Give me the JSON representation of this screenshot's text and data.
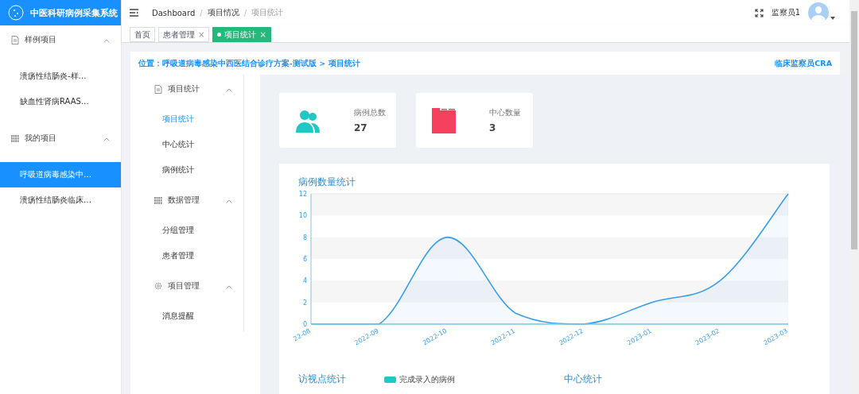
{
  "sidebar": {
    "title": "中医科研病例采集系统",
    "groups": [
      {
        "label": "样例项目",
        "expanded": true,
        "items": [
          {
            "label": "溃疡性结肠炎-样…",
            "selected": false
          },
          {
            "label": "缺血性肾病RAAS…",
            "selected": false
          }
        ]
      },
      {
        "label": "我的项目",
        "expanded": true,
        "items": [
          {
            "label": "呼吸道病毒感染中…",
            "selected": true
          },
          {
            "label": "溃疡性结肠炎临床…",
            "selected": false
          }
        ]
      }
    ]
  },
  "topbar": {
    "breadcrumb": [
      "Dashboard",
      "/",
      "项目情况",
      "/",
      "项目统计"
    ],
    "user": "监察员1"
  },
  "tabs": [
    {
      "label": "首页",
      "selected": false
    },
    {
      "label": "患者管理",
      "selected": false,
      "close": "×"
    },
    {
      "label": "项目统计",
      "selected": true,
      "close": "×"
    }
  ],
  "location": {
    "path": "位置：呼吸道病毒感染中西医结合诊疗方案-测试版 > 项目统计",
    "role": "临床监察员CRA"
  },
  "submenu": [
    {
      "label": "项目统计",
      "expanded": true,
      "items": [
        {
          "label": "项目统计",
          "selected": true
        },
        {
          "label": "中心统计",
          "selected": false
        },
        {
          "label": "病例统计",
          "selected": false
        }
      ]
    },
    {
      "label": "数据管理",
      "expanded": true,
      "items": [
        {
          "label": "分组管理",
          "selected": false
        },
        {
          "label": "患者管理",
          "selected": false
        }
      ]
    },
    {
      "label": "项目管理",
      "expanded": true,
      "items": [
        {
          "label": "消息提醒",
          "selected": false
        }
      ]
    }
  ],
  "stats": [
    {
      "label": "病例总数",
      "value": "27",
      "color": "#1fc8c4"
    },
    {
      "label": "中心数量",
      "value": "3",
      "color": "#f5405e"
    }
  ],
  "chart": {
    "title": "病例数量统计",
    "chart_data": {
      "type": "area",
      "categories": [
        "22-08",
        "2022-09",
        "2022-10",
        "2022-11",
        "2022-12",
        "2023-01",
        "2023-02",
        "2023-03"
      ],
      "series": [
        {
          "color": "#3a9ee8",
          "values": [
            0,
            0,
            8,
            1,
            0,
            2,
            4,
            12
          ]
        }
      ],
      "ylim": [
        0,
        12
      ],
      "yticks": [
        0,
        2,
        4,
        6,
        8,
        10,
        12
      ]
    }
  },
  "bottom": [
    {
      "title": "访视点统计",
      "legend": {
        "label": "完成录入的病例",
        "color": "#1fc8c4"
      }
    },
    {
      "title": "中心统计"
    }
  ]
}
